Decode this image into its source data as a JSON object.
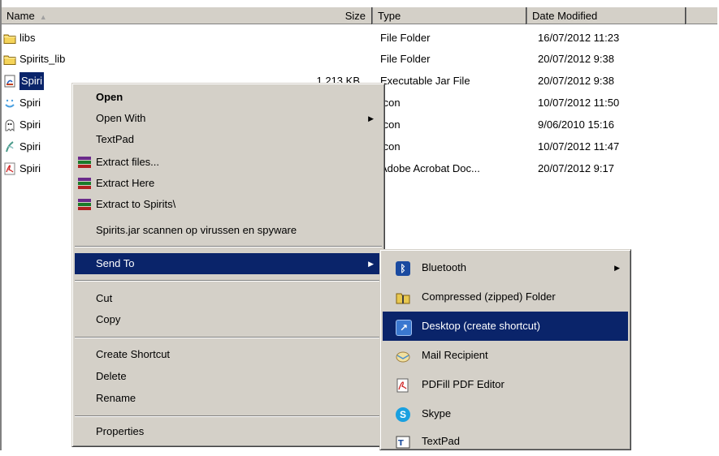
{
  "columns": {
    "name": "Name",
    "size": "Size",
    "type": "Type",
    "date": "Date Modified"
  },
  "files": [
    {
      "name": "libs",
      "size": "",
      "type": "File Folder",
      "date": "16/07/2012 11:23",
      "icon": "folder-icon"
    },
    {
      "name": "Spirits_lib",
      "size": "",
      "type": "File Folder",
      "date": "20/07/2012 9:38",
      "icon": "folder-icon"
    },
    {
      "name": "Spirits.jar",
      "display": "Spiri",
      "size": "1,213 KB",
      "type": "Executable Jar File",
      "date": "20/07/2012 9:38",
      "icon": "jar-icon"
    },
    {
      "name": "Spiri",
      "size": "",
      "type": "Icon",
      "date": "10/07/2012 11:50",
      "icon": "icon-file-icon"
    },
    {
      "name": "Spiri",
      "size": "",
      "type": "Icon",
      "date": "9/06/2010 15:16",
      "icon": "ghost-icon"
    },
    {
      "name": "Spiri",
      "size": "",
      "type": "Icon",
      "date": "10/07/2012 11:47",
      "icon": "icon-file-icon"
    },
    {
      "name": "Spiri",
      "size": "",
      "type": "Adobe Acrobat Doc...",
      "date": "20/07/2012 9:17",
      "icon": "pdf-icon"
    }
  ],
  "context_menu": {
    "open": "Open",
    "open_with": "Open With",
    "textpad": "TextPad",
    "extract_files": "Extract files...",
    "extract_here": "Extract Here",
    "extract_to": "Extract to Spirits\\",
    "scan": "Spirits.jar scannen op virussen en spyware",
    "send_to": "Send To",
    "cut": "Cut",
    "copy": "Copy",
    "create_shortcut": "Create Shortcut",
    "delete": "Delete",
    "rename": "Rename",
    "properties": "Properties"
  },
  "send_to_menu": {
    "bluetooth": "Bluetooth",
    "compressed": "Compressed (zipped) Folder",
    "desktop": "Desktop (create shortcut)",
    "mail": "Mail Recipient",
    "pdfill": "PDFill PDF Editor",
    "skype": "Skype",
    "textpad": "TextPad"
  },
  "colors": {
    "selection": "#0a246a",
    "menu_bg": "#d4d0c8"
  }
}
